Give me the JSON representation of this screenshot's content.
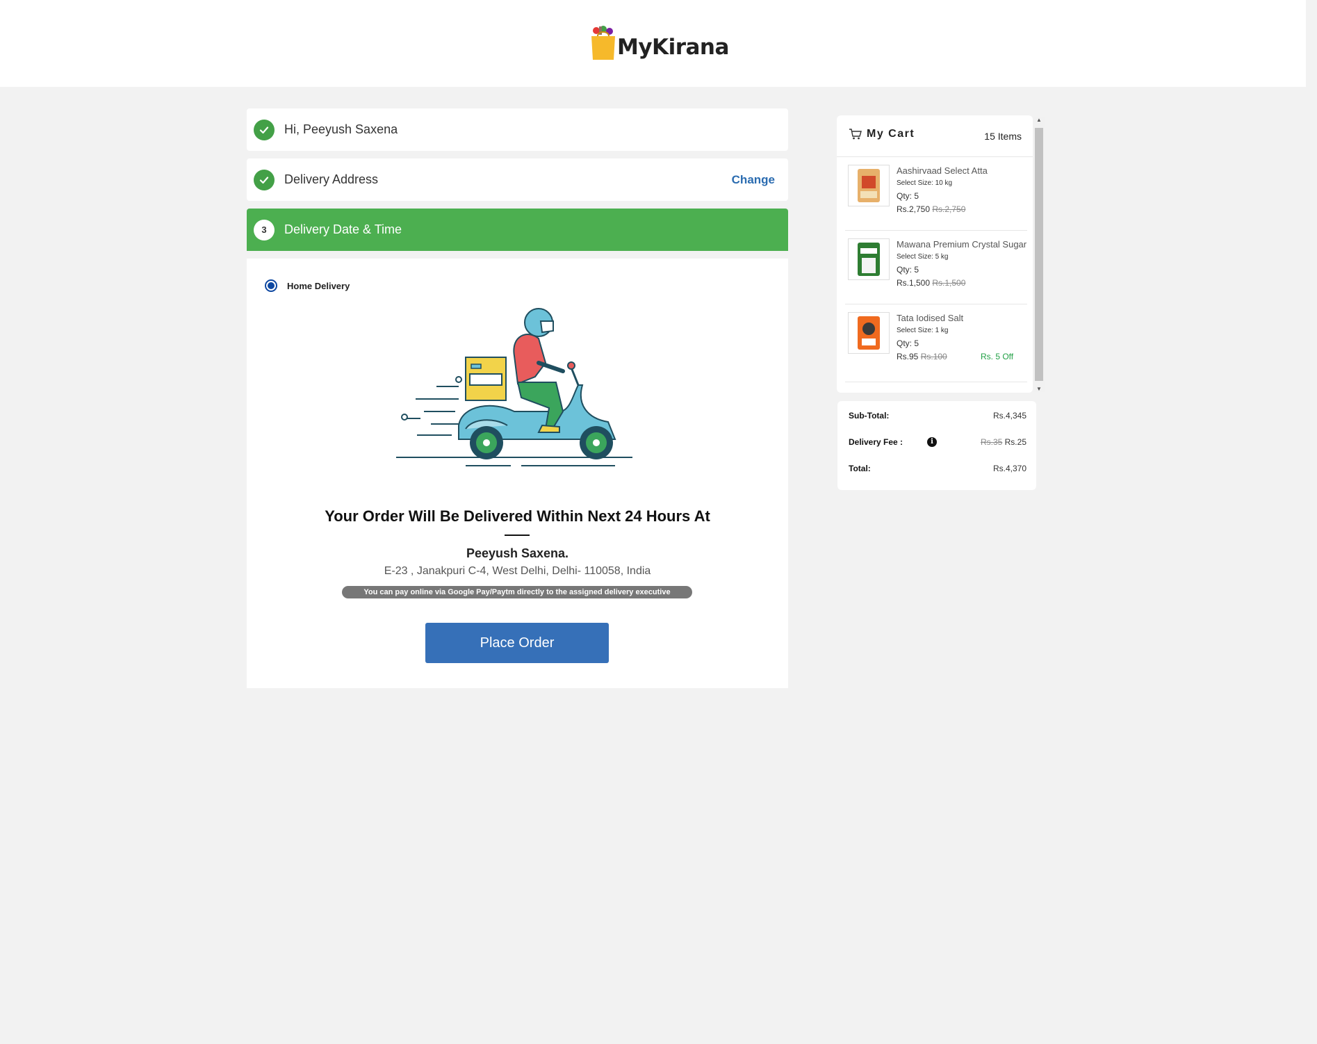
{
  "brand": {
    "name": "MyKirana"
  },
  "steps": {
    "login": {
      "label": "Hi, Peeyush Saxena"
    },
    "address": {
      "label": "Delivery Address",
      "action": "Change"
    },
    "datetime": {
      "number": "3",
      "label": "Delivery Date & Time"
    }
  },
  "delivery": {
    "option_label": "Home Delivery",
    "headline": "Your Order Will Be Delivered Within Next 24 Hours At",
    "customer_name": "Peeyush Saxena.",
    "address": "E-23 , Janakpuri C-4, West Delhi, Delhi- 110058, India",
    "payment_note": "You can pay online via Google Pay/Paytm directly to the assigned delivery executive",
    "place_order_label": "Place Order"
  },
  "cart": {
    "title": "My Cart",
    "count": "15 Items",
    "items": [
      {
        "name": "Aashirvaad Select Atta",
        "size": "Select Size: 10 kg",
        "qty": "Qty: 5",
        "price": "Rs.2,750",
        "mrp": "Rs.2,750",
        "offer": ""
      },
      {
        "name": "Mawana Premium Crystal Sugar",
        "size": "Select Size: 5 kg",
        "qty": "Qty: 5",
        "price": "Rs.1,500",
        "mrp": "Rs.1,500",
        "offer": ""
      },
      {
        "name": "Tata Iodised Salt",
        "size": "Select Size: 1 kg",
        "qty": "Qty: 5",
        "price": "Rs.95",
        "mrp": "Rs.100",
        "offer": "Rs. 5 Off"
      }
    ]
  },
  "summary": {
    "subtotal_label": "Sub-Total:",
    "subtotal": "Rs.4,345",
    "fee_label": "Delivery Fee :",
    "fee_old": "Rs.35",
    "fee": "Rs.25",
    "total_label": "Total:",
    "total": "Rs.4,370"
  },
  "colors": {
    "step_done": "#43a047",
    "step_active": "#4caf50",
    "primary": "#3670b8",
    "offer": "#22a046"
  }
}
